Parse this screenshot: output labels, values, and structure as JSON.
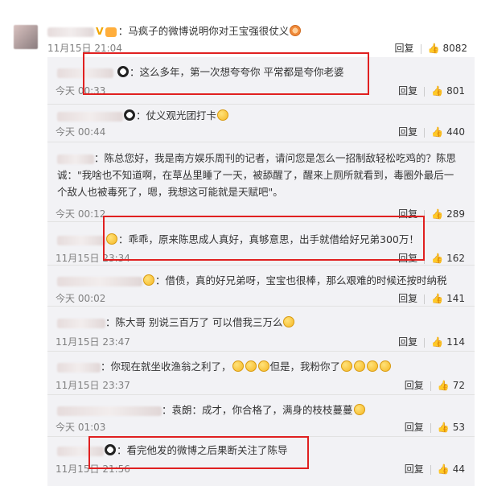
{
  "top": {
    "text": "：马疯子的微博说明你对王宝强很仗义",
    "time": "11月15日 21:04",
    "reply_label": "回复",
    "likes": "8082"
  },
  "replies": [
    {
      "text": "：这么多年，第一次想夸夸你 平常都是夸你老婆",
      "time": "今天 00:33",
      "reply_label": "回复",
      "likes": "801"
    },
    {
      "text": "：仗义观光团打卡",
      "time": "今天 00:44",
      "reply_label": "回复",
      "likes": "440"
    },
    {
      "text1": "：陈总您好，我是南方娱乐周刊的记者，请问您是怎么一招制敌轻松吃鸡的？陈思",
      "text2": "诚：\"我啥也不知道啊，在草丛里睡了一天，被舔醒了，醒来上厕所就看到，毒圈外最后一",
      "text3": "个敌人也被毒死了，嗯，我想这可能就是天赋吧\"。",
      "time": "今天 00:12",
      "reply_label": "回复",
      "likes": "289"
    },
    {
      "text": "：乖乖，原来陈思成人真好，真够意思，出手就借给好兄弟300万！",
      "time": "11月15日 23:34",
      "reply_label": "回复",
      "likes": "162"
    },
    {
      "text": "：借债，真的好兄弟呀，宝宝也很棒，那么艰难的时候还按时纳税",
      "time": "今天 00:02",
      "reply_label": "回复",
      "likes": "141"
    },
    {
      "text": "：陈大哥 别说三百万了 可以借我三万么",
      "time": "11月15日 23:47",
      "reply_label": "回复",
      "likes": "114"
    },
    {
      "text": "：你现在就坐收渔翁之利了，",
      "text_b": "但是，我粉你了",
      "time": "11月15日 23:37",
      "reply_label": "回复",
      "likes": "72"
    },
    {
      "text": "：袁朗：成才，你合格了，满身的枝枝蔓蔓",
      "time": "今天 01:03",
      "reply_label": "回复",
      "likes": "53"
    },
    {
      "text": "：看完他发的微博之后果断关注了陈导",
      "time": "11月15日 21:56",
      "reply_label": "回复",
      "likes": "44"
    }
  ]
}
